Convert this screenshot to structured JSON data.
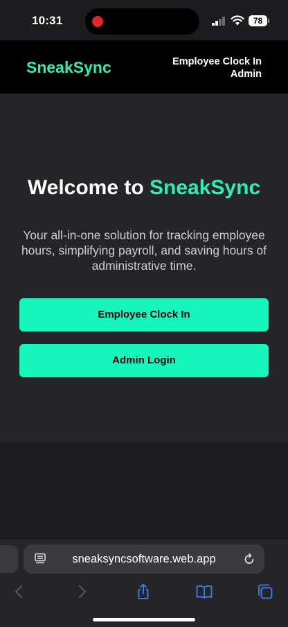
{
  "status_bar": {
    "time": "10:31",
    "battery": "78"
  },
  "header": {
    "brand": "SneakSync",
    "nav": {
      "clock_in": "Employee Clock In",
      "admin": "Admin"
    }
  },
  "hero": {
    "title_prefix": "Welcome to ",
    "title_brand": "SneakSync",
    "description": "Your all-in-one solution for tracking employee hours, simplifying payroll, and saving hours of administrative time.",
    "buttons": {
      "clock_in": "Employee Clock In",
      "admin_login": "Admin Login"
    }
  },
  "browser": {
    "url": "sneaksyncsoftware.web.app",
    "icons": [
      "reader-icon",
      "reload-icon",
      "back-icon",
      "forward-icon",
      "share-icon",
      "bookmarks-icon",
      "tabs-icon"
    ]
  },
  "colors": {
    "accent": "#2bf0b5",
    "button": "#16f5be",
    "header_bg": "#000000",
    "hero_bg": "#252427",
    "page_bg": "#1c1b1d",
    "safari_blue": "#3b82f6"
  }
}
